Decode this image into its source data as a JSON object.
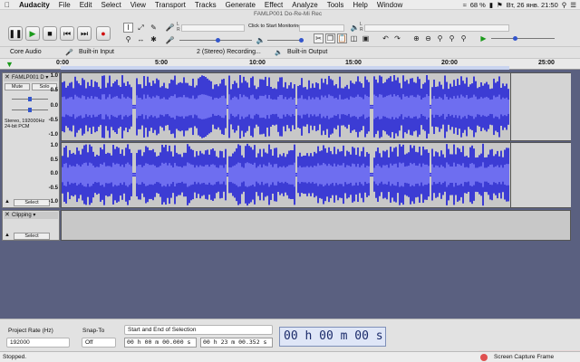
{
  "menubar": {
    "app": "Audacity",
    "items": [
      "File",
      "Edit",
      "Select",
      "View",
      "Transport",
      "Tracks",
      "Generate",
      "Effect",
      "Analyze",
      "Tools",
      "Help",
      "Window"
    ],
    "battery": "68 %",
    "clock": "Вт, 26 янв. 21:50"
  },
  "window": {
    "title": "FAMLP001 Do-Re-Mi Rec"
  },
  "toolbar": {
    "pause_icon": "pause-icon",
    "play_icon": "play-icon",
    "stop_icon": "stop-icon",
    "skip_start_icon": "skip-start-icon",
    "skip_end_icon": "skip-end-icon",
    "record_icon": "record-icon",
    "monitor_label": "Click to Start Monitoring",
    "rec_meter_ticks": [
      "-54",
      "-48",
      "-42",
      "-18",
      "-12",
      "-6",
      "0"
    ],
    "play_meter_ticks": [
      "-54",
      "-48",
      "-42",
      "-36",
      "-30",
      "-24",
      "-18",
      "-12",
      "-6",
      "0"
    ],
    "lr": [
      "L",
      "R"
    ]
  },
  "devices": {
    "host": "Core Audio",
    "input": "Built-in Input",
    "channels": "2 (Stereo) Recording...",
    "output": "Built-in Output"
  },
  "ruler": {
    "ticks": [
      "0:00",
      "5:00",
      "10:00",
      "15:00",
      "20:00",
      "25:00"
    ]
  },
  "tracks": [
    {
      "name": "FAMLP001 D",
      "mute": "Mute",
      "solo": "Solo",
      "info": "Stereo, 192000Hz\n24-bit PCM",
      "select": "Select",
      "amp_top": [
        "1.0",
        "0.5",
        "0.0",
        "-0.5",
        "-1.0"
      ],
      "amp_bot": [
        "1.0",
        "0.5",
        "0.0",
        "-0.5",
        "-1.0"
      ]
    },
    {
      "name": "Clipping",
      "select": "Select"
    }
  ],
  "bottom": {
    "rate_label": "Project Rate (Hz)",
    "rate_value": "192000",
    "snap_label": "Snap-To",
    "snap_value": "Off",
    "sel_mode": "Start and End of Selection",
    "sel_start": "00 h 00 m 00.000 s",
    "sel_end": "00 h 23 m 00.352 s",
    "audio_pos": "00 h 00 m 00 s"
  },
  "status": {
    "text": "Stopped.",
    "capture": "Screen Capture Frame"
  },
  "colors": {
    "wave": "#3c3cd4",
    "wave_rms": "#6e6ef0"
  }
}
